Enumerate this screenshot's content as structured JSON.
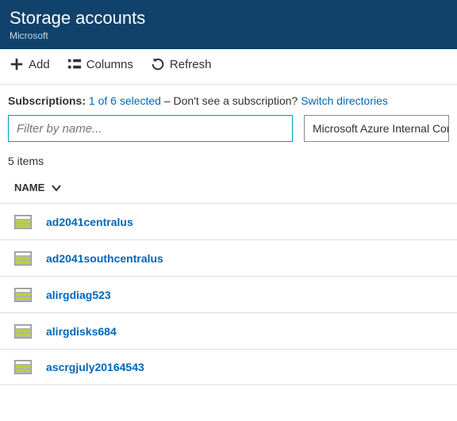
{
  "header": {
    "title": "Storage accounts",
    "subtitle": "Microsoft"
  },
  "toolbar": {
    "add": "Add",
    "columns": "Columns",
    "refresh": "Refresh"
  },
  "subscriptions": {
    "label": "Subscriptions:",
    "selected": "1 of 6 selected",
    "hint_prefix": " – Don't see a subscription? ",
    "switch": "Switch directories"
  },
  "filter": {
    "placeholder": "Filter by name..."
  },
  "dropdown": {
    "value": "Microsoft Azure Internal Consumption"
  },
  "count_label": "5 items",
  "columns": {
    "name": "NAME"
  },
  "items": [
    {
      "name": "ad2041centralus"
    },
    {
      "name": "ad2041southcentralus"
    },
    {
      "name": "alirgdiag523"
    },
    {
      "name": "alirgdisks684"
    },
    {
      "name": "ascrgjuly20164543"
    }
  ]
}
